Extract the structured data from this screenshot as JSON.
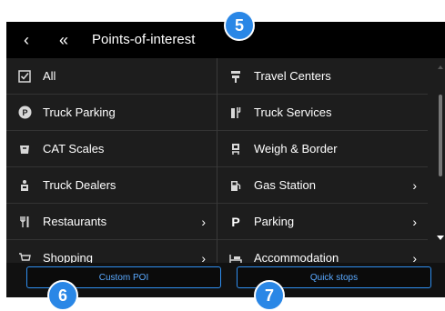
{
  "header": {
    "title": "Points-of-interest",
    "back_icon": "chevron-left-icon",
    "back_all_icon": "double-chevron-left-icon"
  },
  "left_items": [
    {
      "label": "All",
      "icon": "checkbox-icon",
      "has_chevron": false
    },
    {
      "label": "Truck Parking",
      "icon": "parking-circle-icon",
      "has_chevron": false
    },
    {
      "label": "CAT Scales",
      "icon": "cat-scales-icon",
      "has_chevron": false
    },
    {
      "label": "Truck Dealers",
      "icon": "dealer-icon",
      "has_chevron": false
    },
    {
      "label": "Restaurants",
      "icon": "fork-knife-icon",
      "has_chevron": true
    },
    {
      "label": "Shopping",
      "icon": "cart-icon",
      "has_chevron": true
    }
  ],
  "right_items": [
    {
      "label": "Travel Centers",
      "icon": "travel-center-icon",
      "has_chevron": false
    },
    {
      "label": "Truck Services",
      "icon": "tools-icon",
      "has_chevron": false
    },
    {
      "label": "Weigh & Border",
      "icon": "scale-icon",
      "has_chevron": false
    },
    {
      "label": "Gas Station",
      "icon": "fuel-pump-icon",
      "has_chevron": true
    },
    {
      "label": "Parking",
      "icon": "parking-p-icon",
      "has_chevron": true
    },
    {
      "label": "Accommodation",
      "icon": "bed-icon",
      "has_chevron": true
    }
  ],
  "footer": {
    "custom_poi_label": "Custom POI",
    "quick_stops_label": "Quick stops"
  },
  "badges": {
    "b5": "5",
    "b6": "6",
    "b7": "7"
  },
  "colors": {
    "accent": "#2a87e6",
    "button_border": "#2f8ff0",
    "background": "#1d1d1d",
    "header": "#000000"
  }
}
